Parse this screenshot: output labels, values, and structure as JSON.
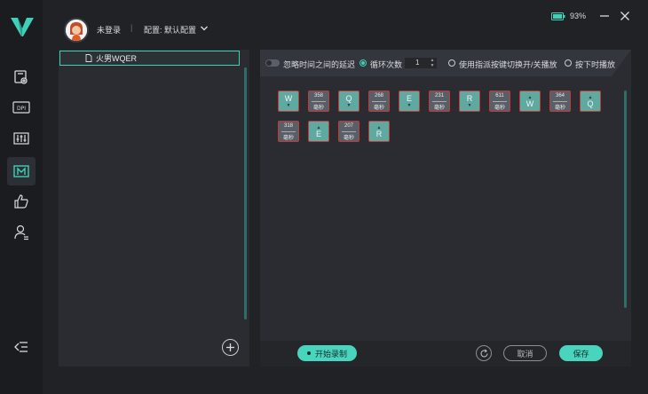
{
  "header": {
    "login_status": "未登录",
    "separator": "|",
    "config_label": "配置: 默认配置"
  },
  "window": {
    "battery_percent": "93%"
  },
  "sidebar": {
    "items": [
      {
        "name": "device-settings-icon"
      },
      {
        "name": "dpi-icon"
      },
      {
        "name": "equalizer-icon"
      },
      {
        "name": "macro-icon",
        "active": true
      },
      {
        "name": "thumbs-up-icon"
      },
      {
        "name": "user-icon"
      }
    ]
  },
  "macro_list": {
    "items": [
      {
        "label": "火男WQER",
        "selected": true
      }
    ]
  },
  "toolbar": {
    "ignore_delay_label": "忽略时间之间的延迟",
    "loop_count_label": "循环次数",
    "loop_count_value": "1",
    "toggle_key_label": "使用指派按键切换开/关播放",
    "hold_play_label": "按下时播放"
  },
  "sequence": [
    {
      "type": "key",
      "key": "W",
      "dir": "down"
    },
    {
      "type": "delay",
      "ms": "358",
      "unit": "毫秒"
    },
    {
      "type": "key",
      "key": "Q",
      "dir": "down"
    },
    {
      "type": "delay",
      "ms": "268",
      "unit": "毫秒"
    },
    {
      "type": "key",
      "key": "E",
      "dir": "down"
    },
    {
      "type": "delay",
      "ms": "231",
      "unit": "毫秒"
    },
    {
      "type": "key",
      "key": "R",
      "dir": "down"
    },
    {
      "type": "delay",
      "ms": "611",
      "unit": "毫秒"
    },
    {
      "type": "key",
      "key": "W",
      "dir": "up"
    },
    {
      "type": "delay",
      "ms": "364",
      "unit": "毫秒"
    },
    {
      "type": "key",
      "key": "Q",
      "dir": "up"
    },
    {
      "type": "delay",
      "ms": "318",
      "unit": "毫秒"
    },
    {
      "type": "key",
      "key": "E",
      "dir": "up"
    },
    {
      "type": "delay",
      "ms": "207",
      "unit": "毫秒"
    },
    {
      "type": "key",
      "key": "R",
      "dir": "up"
    }
  ],
  "bottom_bar": {
    "record_label": "开始录制",
    "cancel_label": "取消",
    "save_label": "保存"
  },
  "colors": {
    "accent": "#48d4bd",
    "key_fill": "#5fa9a0",
    "key_border": "#c03a3a"
  }
}
